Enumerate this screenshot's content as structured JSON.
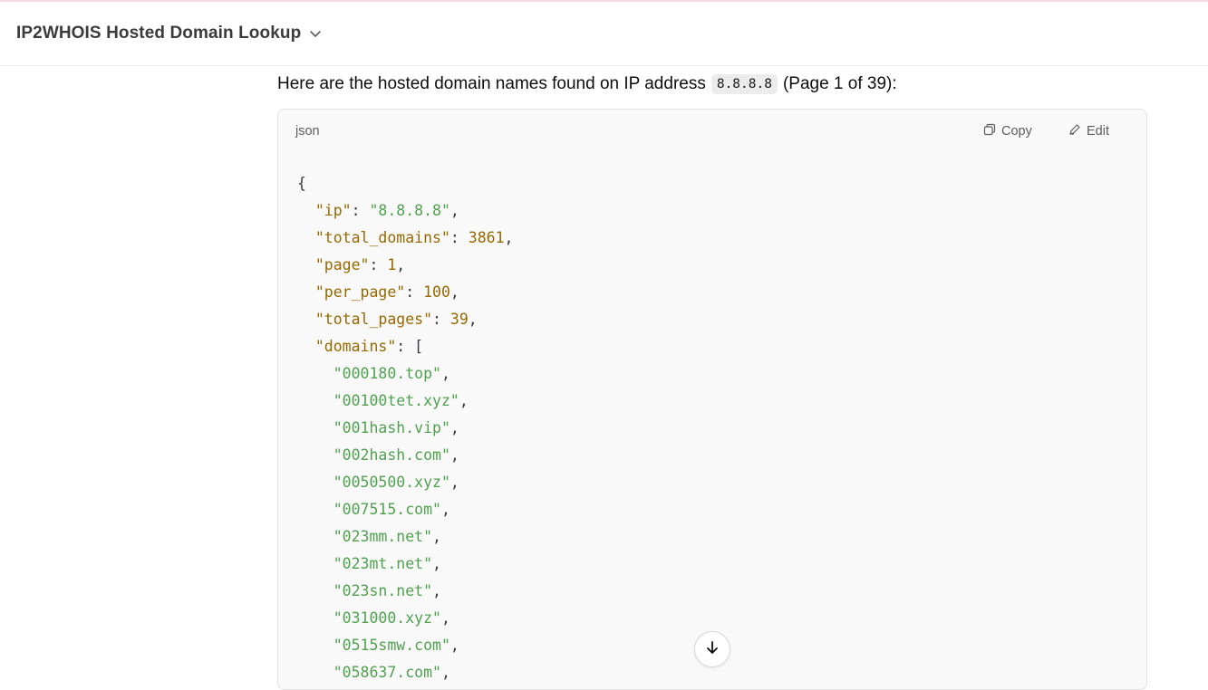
{
  "header": {
    "title": "IP2WHOIS Hosted Domain Lookup",
    "dropdown_icon": "chevron-down-icon"
  },
  "message": {
    "intro_before": "Here are the hosted domain names found on IP address",
    "ip_code": "8.8.8.8",
    "intro_after": "(Page 1 of 39):"
  },
  "codeblock": {
    "language": "json",
    "copy_label": "Copy",
    "edit_label": "Edit",
    "open_brace": "{",
    "fields": [
      {
        "key": "\"ip\"",
        "value": "\"8.8.8.8\"",
        "type": "string"
      },
      {
        "key": "\"total_domains\"",
        "value": "3861",
        "type": "number"
      },
      {
        "key": "\"page\"",
        "value": "1",
        "type": "number"
      },
      {
        "key": "\"per_page\"",
        "value": "100",
        "type": "number"
      },
      {
        "key": "\"total_pages\"",
        "value": "39",
        "type": "number"
      }
    ],
    "domains_key": "\"domains\"",
    "domains": [
      "\"000180.top\"",
      "\"00100tet.xyz\"",
      "\"001hash.vip\"",
      "\"002hash.com\"",
      "\"0050500.xyz\"",
      "\"007515.com\"",
      "\"023mm.net\"",
      "\"023mt.net\"",
      "\"023sn.net\"",
      "\"031000.xyz\"",
      "\"0515smw.com\"",
      "\"058637.com\""
    ]
  },
  "scroll_down_icon": "arrow-down-icon"
}
